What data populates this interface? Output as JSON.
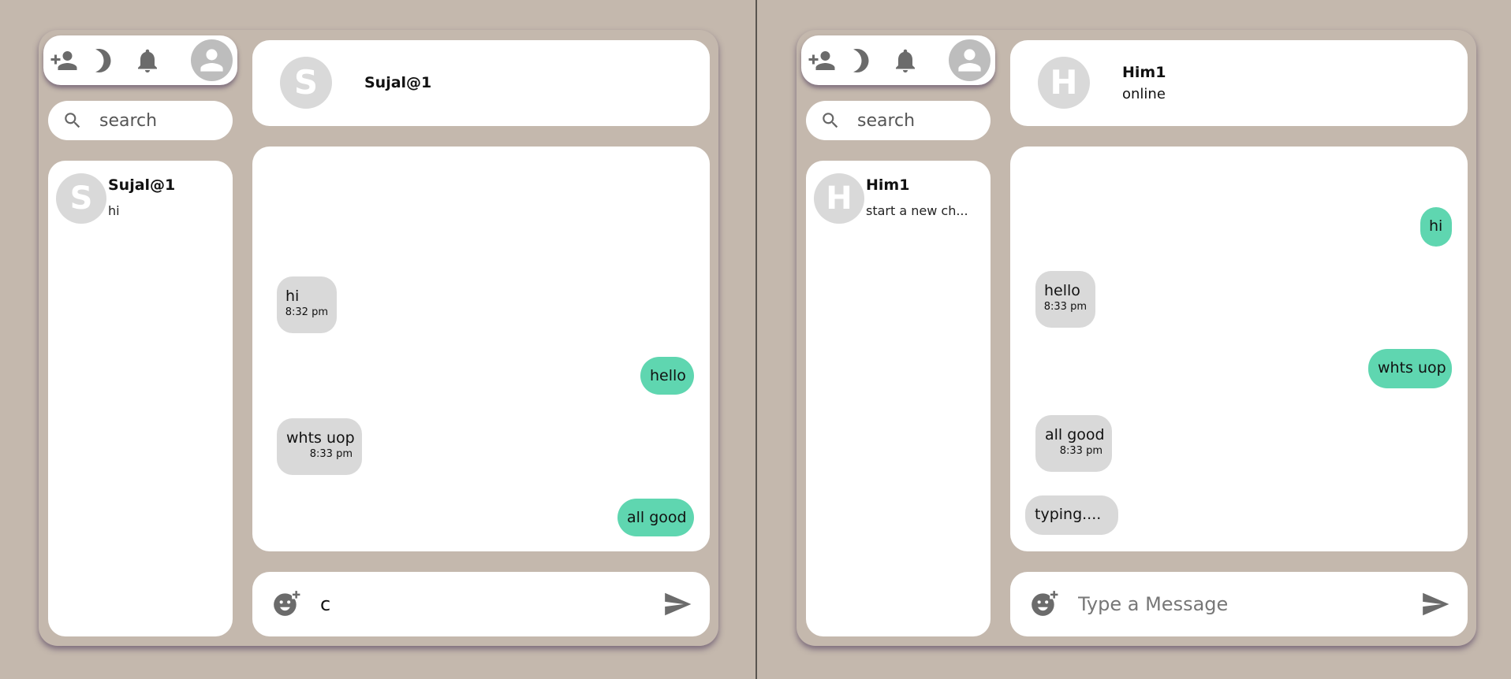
{
  "left": {
    "search_placeholder": "search",
    "chat_item": {
      "initial": "S",
      "name": "Sujal@1",
      "preview": "hi"
    },
    "header": {
      "initial": "S",
      "name": "Sujal@1"
    },
    "messages": [
      {
        "text": "hi",
        "time": "8:32 pm",
        "dir": "in"
      },
      {
        "text": "hello",
        "dir": "out"
      },
      {
        "text": "whts uop",
        "time": "8:33 pm",
        "dir": "in"
      },
      {
        "text": "all good",
        "dir": "out"
      }
    ],
    "input": {
      "value": "c",
      "placeholder": "Type a Message"
    }
  },
  "right": {
    "search_placeholder": "search",
    "chat_item": {
      "initial": "H",
      "name": "Him1",
      "preview": "start a new ch..."
    },
    "header": {
      "initial": "H",
      "name": "Him1",
      "status": "online"
    },
    "messages": [
      {
        "text": "hi",
        "dir": "out"
      },
      {
        "text": "hello",
        "time": "8:33 pm",
        "dir": "in"
      },
      {
        "text": "whts uop",
        "dir": "out"
      },
      {
        "text": "all good",
        "time": "8:33 pm",
        "dir": "in"
      }
    ],
    "typing": "typing....",
    "input": {
      "value": "",
      "placeholder": "Type a Message"
    }
  },
  "icons": [
    "add-person-icon",
    "moon-icon",
    "bell-icon",
    "user-icon",
    "search-icon",
    "add-emoji-icon",
    "send-icon"
  ],
  "colors": {
    "background": "#c4b8ad",
    "outgoing_bubble": "#5fd6b0",
    "incoming_bubble": "#d9d9d9",
    "icon": "#6b6b6b"
  }
}
